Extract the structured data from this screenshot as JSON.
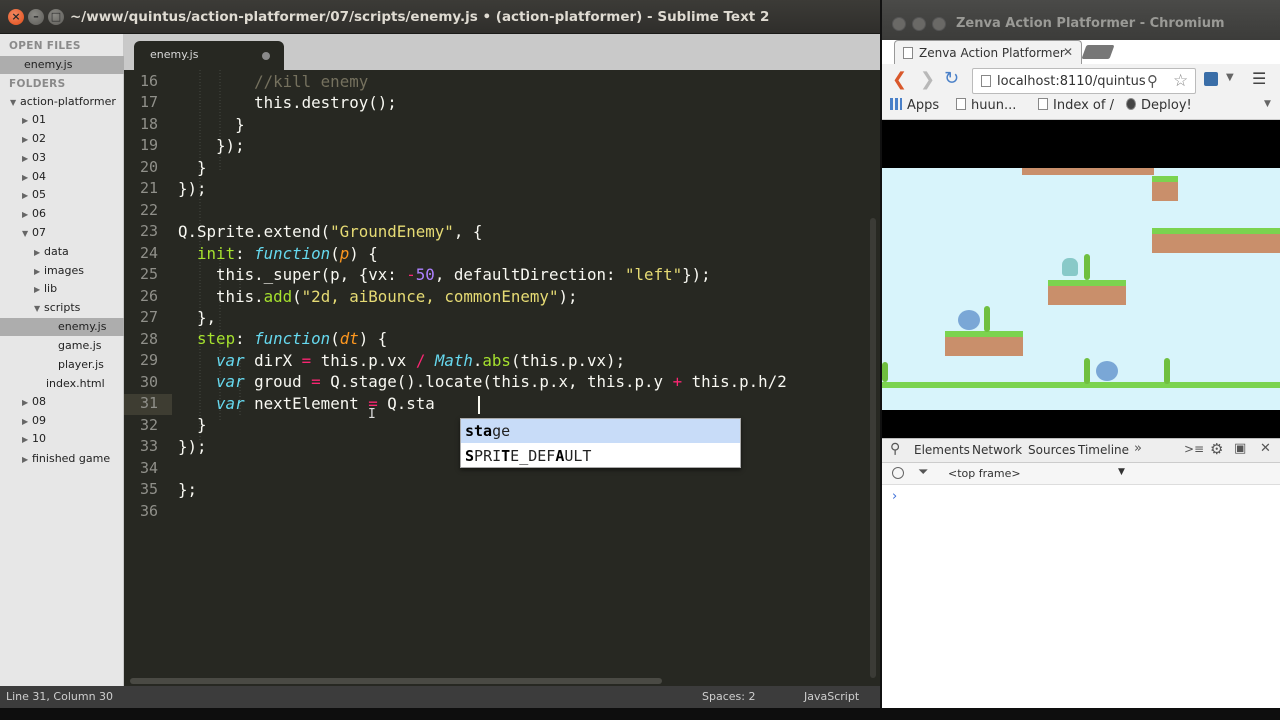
{
  "sublime": {
    "title": "~/www/quintus/action-platformer/07/scripts/enemy.js • (action-platformer) - Sublime Text 2",
    "sidebar": {
      "open_files_header": "OPEN FILES",
      "open_files": [
        "enemy.js"
      ],
      "folders_header": "FOLDERS",
      "project": "action-platformer",
      "folders": [
        "01",
        "02",
        "03",
        "04",
        "05",
        "06",
        "07",
        "data",
        "images",
        "lib",
        "scripts",
        "enemy.js",
        "game.js",
        "player.js",
        "index.html",
        "08",
        "09",
        "10",
        "finished game"
      ]
    },
    "tab": {
      "label": "enemy.js"
    },
    "line_numbers": [
      "16",
      "17",
      "18",
      "19",
      "20",
      "21",
      "22",
      "23",
      "24",
      "25",
      "26",
      "27",
      "28",
      "29",
      "30",
      "31",
      "32",
      "33",
      "34",
      "35",
      "36"
    ],
    "autocomplete": {
      "items": [
        {
          "match": "sta",
          "rest": "ge"
        },
        {
          "text": "SPRITE_DEFAULT"
        }
      ]
    },
    "status": {
      "position": "Line 31, Column 30",
      "indent": "Spaces: 2",
      "syntax": "JavaScript"
    }
  },
  "chromium": {
    "title": "Zenva Action Platformer - Chromium",
    "tab_label": "Zenva Action Platformer",
    "url": "localhost:8110/quintus",
    "bookmarks": [
      "Apps",
      "huun...",
      "Index of /",
      "Deploy!"
    ],
    "devtools": {
      "tabs": [
        "Elements",
        "Network",
        "Sources",
        "Timeline"
      ],
      "frame": "<top frame>",
      "prompt": "›"
    }
  }
}
